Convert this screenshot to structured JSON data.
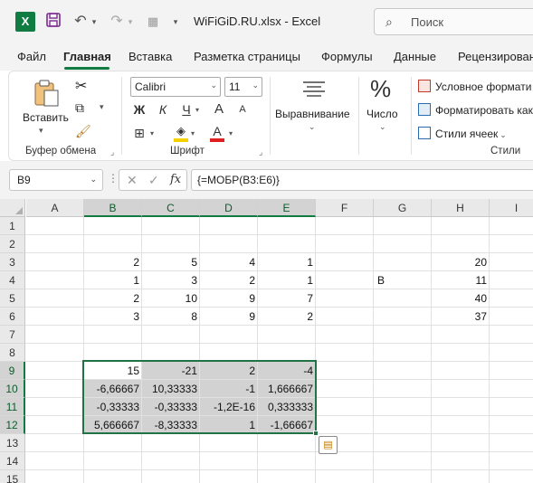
{
  "window": {
    "file_title": "WiFiGiD.RU.xlsx  -  Excel",
    "search_placeholder": "Поиск",
    "app_letter": "X"
  },
  "tabs": [
    {
      "label": "Файл",
      "active": false
    },
    {
      "label": "Главная",
      "active": true
    },
    {
      "label": "Вставка",
      "active": false
    },
    {
      "label": "Разметка страницы",
      "active": false
    },
    {
      "label": "Формулы",
      "active": false
    },
    {
      "label": "Данные",
      "active": false
    },
    {
      "label": "Рецензирован",
      "active": false
    }
  ],
  "ribbon": {
    "clipboard": {
      "paste_label": "Вставить",
      "group_label": "Буфер обмена"
    },
    "font": {
      "font_name": "Calibri",
      "font_size": "11",
      "bold": "Ж",
      "italic": "К",
      "underline": "Ч",
      "grow": "A",
      "shrink": "A",
      "group_label": "Шрифт",
      "fill_color": "#f5d100",
      "font_color": "#e02020"
    },
    "alignment": {
      "label": "Выравнивание"
    },
    "number": {
      "label": "Число",
      "symbol": "%"
    },
    "styles": {
      "conditional": "Условное формати",
      "format_table": "Форматировать как",
      "cell_styles": "Стили ячеек",
      "group_label": "Стили"
    }
  },
  "formula_bar": {
    "name_box": "B9",
    "formula": "{=МОБР(B3:E6)}",
    "fx": "fx"
  },
  "sheet": {
    "columns": [
      "A",
      "B",
      "C",
      "D",
      "E",
      "F",
      "G",
      "H",
      "I"
    ],
    "selected_columns": [
      "B",
      "C",
      "D",
      "E"
    ],
    "rows": [
      "1",
      "2",
      "3",
      "4",
      "5",
      "6",
      "7",
      "8",
      "9",
      "10",
      "11",
      "12",
      "13",
      "14",
      "15"
    ],
    "selected_rows": [
      "9",
      "10",
      "11",
      "12"
    ],
    "cells": [
      {
        "ref": "B3",
        "value": "2"
      },
      {
        "ref": "C3",
        "value": "5"
      },
      {
        "ref": "D3",
        "value": "4"
      },
      {
        "ref": "E3",
        "value": "1"
      },
      {
        "ref": "H3",
        "value": "20"
      },
      {
        "ref": "B4",
        "value": "1"
      },
      {
        "ref": "C4",
        "value": "3"
      },
      {
        "ref": "D4",
        "value": "2"
      },
      {
        "ref": "E4",
        "value": "1"
      },
      {
        "ref": "G4",
        "value": "B",
        "type": "text"
      },
      {
        "ref": "H4",
        "value": "11"
      },
      {
        "ref": "B5",
        "value": "2"
      },
      {
        "ref": "C5",
        "value": "10"
      },
      {
        "ref": "D5",
        "value": "9"
      },
      {
        "ref": "E5",
        "value": "7"
      },
      {
        "ref": "H5",
        "value": "40"
      },
      {
        "ref": "B6",
        "value": "3"
      },
      {
        "ref": "C6",
        "value": "8"
      },
      {
        "ref": "D6",
        "value": "9"
      },
      {
        "ref": "E6",
        "value": "2"
      },
      {
        "ref": "H6",
        "value": "37"
      },
      {
        "ref": "B9",
        "value": "15"
      },
      {
        "ref": "C9",
        "value": "-21"
      },
      {
        "ref": "D9",
        "value": "2"
      },
      {
        "ref": "E9",
        "value": "-4"
      },
      {
        "ref": "B10",
        "value": "-6,66667"
      },
      {
        "ref": "C10",
        "value": "10,33333"
      },
      {
        "ref": "D10",
        "value": "-1"
      },
      {
        "ref": "E10",
        "value": "1,666667"
      },
      {
        "ref": "B11",
        "value": "-0,33333"
      },
      {
        "ref": "C11",
        "value": "-0,33333"
      },
      {
        "ref": "D11",
        "value": "-1,2E-16"
      },
      {
        "ref": "E11",
        "value": "0,333333"
      },
      {
        "ref": "B12",
        "value": "5,666667"
      },
      {
        "ref": "C12",
        "value": "-8,33333"
      },
      {
        "ref": "D12",
        "value": "1"
      },
      {
        "ref": "E12",
        "value": "-1,66667"
      }
    ]
  },
  "colors": {
    "accent": "#107c41",
    "selection_border": "#217346"
  }
}
